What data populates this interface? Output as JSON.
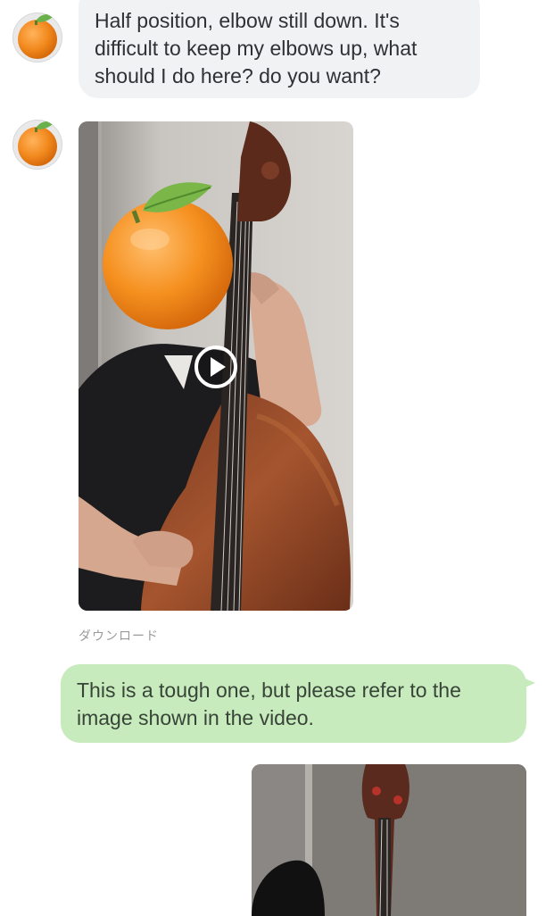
{
  "chat": {
    "incoming_message_1": {
      "text": "Half position, elbow still down. It's difficult to keep my elbows up, what should I do here? do you want?",
      "avatar_icon": "orange-icon"
    },
    "incoming_video": {
      "avatar_icon": "orange-icon",
      "play_icon": "play-icon",
      "download_label": "ダウンロード"
    },
    "outgoing_message_1": {
      "text": "This is a tough one, but please refer to the image shown in the video."
    },
    "outgoing_video": {}
  },
  "colors": {
    "incoming_bubble": "#f1f2f4",
    "outgoing_bubble": "#c7ebbd",
    "text": "#2e3135"
  }
}
